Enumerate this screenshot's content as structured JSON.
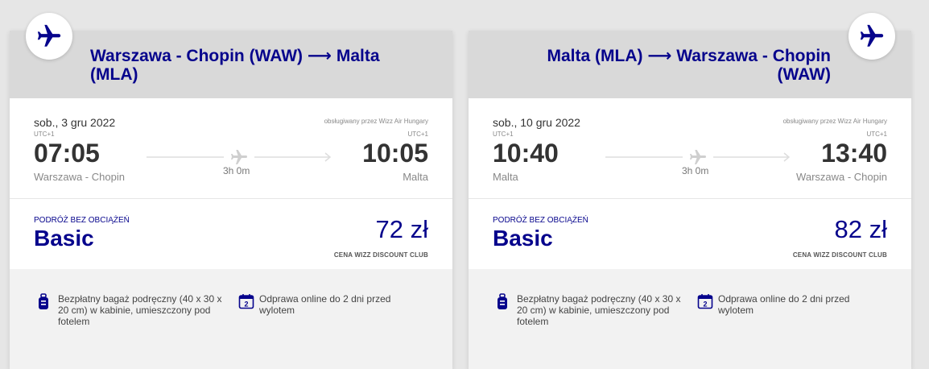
{
  "colors": {
    "brand": "#06048c",
    "header_bg": "#d9d9d9",
    "page_bg": "#e6e6e6"
  },
  "flights": [
    {
      "title": "Warszawa - Chopin (WAW) ⟶ Malta (MLA)",
      "date": "sob., 3 gru 2022",
      "operated_by": "obsługiwany przez Wizz Air Hungary",
      "departure": {
        "utc": "UTC+1",
        "time": "07:05",
        "city": "Warszawa - Chopin"
      },
      "arrival": {
        "utc": "UTC+1",
        "time": "10:05",
        "city": "Malta"
      },
      "duration": "3h 0m",
      "fare_label": "PODRÓŻ BEZ OBCIĄŻEŃ",
      "fare_name": "Basic",
      "price": "72 zł",
      "club_label": "CENA WIZZ DISCOUNT CLUB",
      "benefits": [
        {
          "icon": "carry-on-bag-icon",
          "text": "Bezpłatny bagaż podręczny (40 x 30 x 20 cm) w kabinie, umieszczony pod fotelem"
        },
        {
          "icon": "calendar-2-icon",
          "icon_text": "2",
          "text": "Odprawa online do 2 dni przed wylotem"
        }
      ]
    },
    {
      "title": "Malta (MLA) ⟶ Warszawa - Chopin (WAW)",
      "date": "sob., 10 gru 2022",
      "operated_by": "obsługiwany przez Wizz Air Hungary",
      "departure": {
        "utc": "UTC+1",
        "time": "10:40",
        "city": "Malta"
      },
      "arrival": {
        "utc": "UTC+1",
        "time": "13:40",
        "city": "Warszawa - Chopin"
      },
      "duration": "3h 0m",
      "fare_label": "PODRÓŻ BEZ OBCIĄŻEŃ",
      "fare_name": "Basic",
      "price": "82 zł",
      "club_label": "CENA WIZZ DISCOUNT CLUB",
      "benefits": [
        {
          "icon": "carry-on-bag-icon",
          "text": "Bezpłatny bagaż podręczny (40 x 30 x 20 cm) w kabinie, umieszczony pod fotelem"
        },
        {
          "icon": "calendar-2-icon",
          "icon_text": "2",
          "text": "Odprawa online do 2 dni przed wylotem"
        }
      ]
    }
  ]
}
